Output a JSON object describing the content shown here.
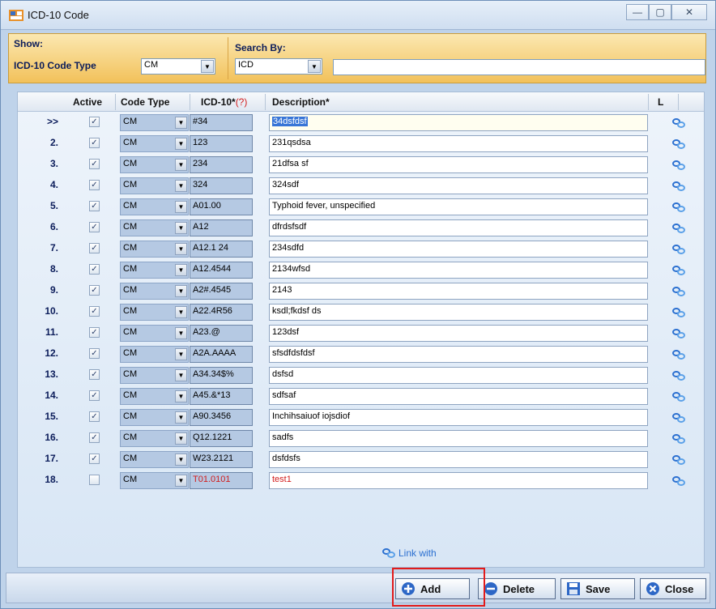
{
  "window": {
    "title": "ICD-10 Code"
  },
  "filter": {
    "show_label": "Show:",
    "code_type_label": "ICD-10 Code Type",
    "code_type_value": "CM",
    "search_by_label": "Search By:",
    "search_by_value": "ICD",
    "search_value": ""
  },
  "grid": {
    "columns": {
      "active": "Active",
      "code_type": "Code Type",
      "icd": "ICD-10*",
      "icd_q": "(?)",
      "description": "Description*",
      "link": "L"
    },
    "rows": [
      {
        "num": ">>",
        "active": true,
        "code_type": "CM",
        "icd": "#34",
        "description": "34dsfdsf"
      },
      {
        "num": "2.",
        "active": true,
        "code_type": "CM",
        "icd": "123",
        "description": "231qsdsa"
      },
      {
        "num": "3.",
        "active": true,
        "code_type": "CM",
        "icd": "234",
        "description": "21dfsa sf"
      },
      {
        "num": "4.",
        "active": true,
        "code_type": "CM",
        "icd": "324",
        "description": "324sdf"
      },
      {
        "num": "5.",
        "active": true,
        "code_type": "CM",
        "icd": "A01.00",
        "description": "Typhoid fever, unspecified"
      },
      {
        "num": "6.",
        "active": true,
        "code_type": "CM",
        "icd": "A12",
        "description": "dfrdsfsdf"
      },
      {
        "num": "7.",
        "active": true,
        "code_type": "CM",
        "icd": "A12.1 24",
        "description": "234sdfd"
      },
      {
        "num": "8.",
        "active": true,
        "code_type": "CM",
        "icd": "A12.4544",
        "description": "2134wfsd"
      },
      {
        "num": "9.",
        "active": true,
        "code_type": "CM",
        "icd": "A2#.4545",
        "description": "2143"
      },
      {
        "num": "10.",
        "active": true,
        "code_type": "CM",
        "icd": "A22.4R56",
        "description": "ksdl;fkdsf ds"
      },
      {
        "num": "11.",
        "active": true,
        "code_type": "CM",
        "icd": "A23.@",
        "description": "123dsf"
      },
      {
        "num": "12.",
        "active": true,
        "code_type": "CM",
        "icd": "A2A.AAAA",
        "description": "sfsdfdsfdsf"
      },
      {
        "num": "13.",
        "active": true,
        "code_type": "CM",
        "icd": "A34.34$%",
        "description": "dsfsd"
      },
      {
        "num": "14.",
        "active": true,
        "code_type": "CM",
        "icd": "A45.&*13",
        "description": "sdfsaf"
      },
      {
        "num": "15.",
        "active": true,
        "code_type": "CM",
        "icd": "A90.3456",
        "description": "Inchihsaiuof iojsdiof"
      },
      {
        "num": "16.",
        "active": true,
        "code_type": "CM",
        "icd": "Q12.1221",
        "description": "sadfs"
      },
      {
        "num": "17.",
        "active": true,
        "code_type": "CM",
        "icd": "W23.2121",
        "description": "dsfdsfs"
      },
      {
        "num": "18.",
        "active": false,
        "code_type": "CM",
        "icd": "T01.0101",
        "description": "test1",
        "new": true
      }
    ],
    "legend": "Link with"
  },
  "footer": {
    "add": "Add",
    "delete": "Delete",
    "save": "Save",
    "close": "Close"
  },
  "colors": {
    "accent_red": "#d21c1c",
    "link_blue": "#2a6fd0",
    "filter_bg": "#f2c15a"
  },
  "icons": {
    "link": "link-icon",
    "add": "add-icon",
    "delete": "delete-icon",
    "save": "save-icon",
    "close": "close-icon"
  }
}
